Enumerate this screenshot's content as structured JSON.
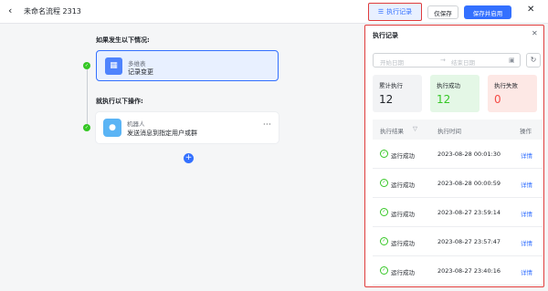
{
  "header": {
    "back_icon": "chevron-left-icon",
    "title": "未命名流程 2313",
    "exec_log_label": "执行记录",
    "save_only_label": "仅保存",
    "save_enable_label": "保存并启用",
    "close_icon": "close-icon"
  },
  "flow": {
    "condition_label": "如果发生以下情况:",
    "trigger": {
      "type": "多维表",
      "event": "记录变更",
      "icon": "table-icon"
    },
    "action_label": "就执行以下操作:",
    "action": {
      "type": "机器人",
      "desc": "发送消息到指定用户或群",
      "icon": "robot-icon"
    },
    "more_label": "···",
    "add_label": "+"
  },
  "panel": {
    "title": "执行记录",
    "start_placeholder": "开始日期",
    "end_placeholder": "结束日期",
    "arrow": "→",
    "stats": {
      "total_label": "累计执行",
      "total_value": "12",
      "success_label": "执行成功",
      "success_value": "12",
      "fail_label": "执行失败",
      "fail_value": "0"
    },
    "columns": {
      "result": "执行结果",
      "time": "执行时间",
      "op": "操作"
    },
    "rows": [
      {
        "result": "运行成功",
        "time": "2023-08-28 00:01:30",
        "op": "详情"
      },
      {
        "result": "运行成功",
        "time": "2023-08-28 00:00:59",
        "op": "详情"
      },
      {
        "result": "运行成功",
        "time": "2023-08-27 23:59:14",
        "op": "详情"
      },
      {
        "result": "运行成功",
        "time": "2023-08-27 23:57:47",
        "op": "详情"
      },
      {
        "result": "运行成功",
        "time": "2023-08-27 23:40:16",
        "op": "详情"
      }
    ]
  },
  "colors": {
    "accent": "#3370ff",
    "success": "#34c724",
    "danger": "#f54a45",
    "highlight": "#e03c3c"
  }
}
